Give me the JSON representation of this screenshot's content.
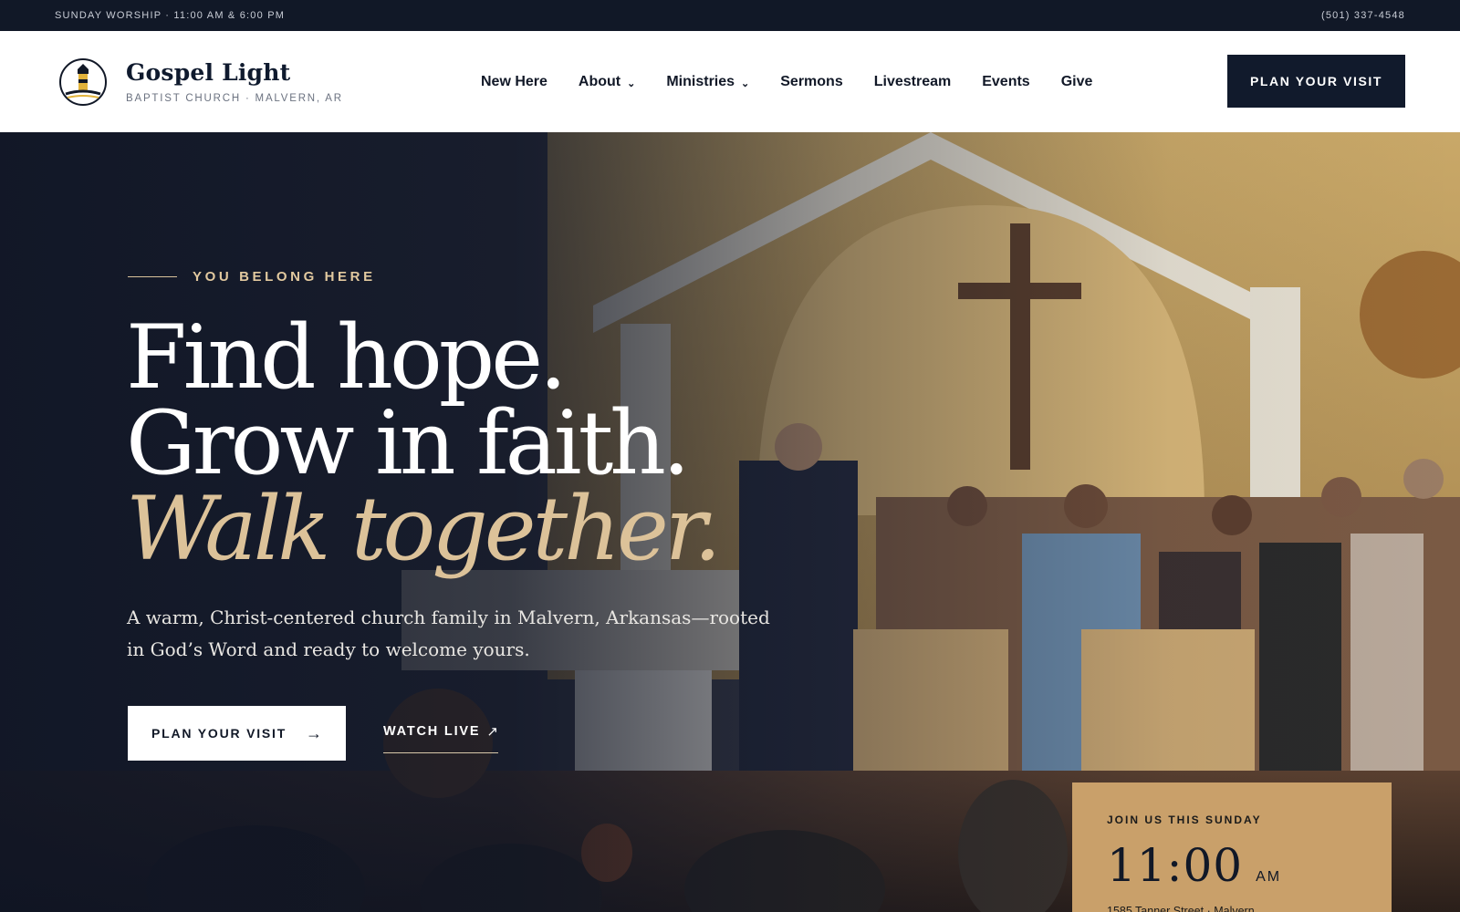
{
  "topbar": {
    "service_times": "SUNDAY WORSHIP · 11:00 AM & 6:00 PM",
    "phone": "(501) 337-4548"
  },
  "header": {
    "brand_name": "Gospel Light",
    "brand_sub": "BAPTIST CHURCH · MALVERN, AR",
    "logo_icon": "lighthouse-icon",
    "nav": [
      {
        "label": "New Here",
        "dropdown": false
      },
      {
        "label": "About",
        "dropdown": true
      },
      {
        "label": "Ministries",
        "dropdown": true
      },
      {
        "label": "Sermons",
        "dropdown": false
      },
      {
        "label": "Livestream",
        "dropdown": false
      },
      {
        "label": "Events",
        "dropdown": false
      },
      {
        "label": "Give",
        "dropdown": false
      }
    ],
    "chevron": "⌄",
    "cta_label": "PLAN YOUR VISIT"
  },
  "hero": {
    "eyebrow": "YOU BELONG HERE",
    "headline_1": "Find hope.",
    "headline_2": "Grow in faith.",
    "headline_3": "Walk together.",
    "subtext": "A warm, Christ-centered church family in Malvern, Arkansas—rooted in God’s Word and ready to welcome yours.",
    "primary_button": {
      "label": "PLAN YOUR VISIT",
      "arrow": "→"
    },
    "secondary_button": {
      "label": "WATCH LIVE",
      "arrow": "↗"
    }
  },
  "service_card": {
    "label": "JOIN US THIS SUNDAY",
    "time": "11:00",
    "ampm": "AM",
    "address": "1585 Tanner Street · Malvern"
  },
  "colors": {
    "navy": "#111827",
    "gold": "#c9a06a",
    "cream_accent": "#dcc299",
    "white": "#ffffff"
  }
}
